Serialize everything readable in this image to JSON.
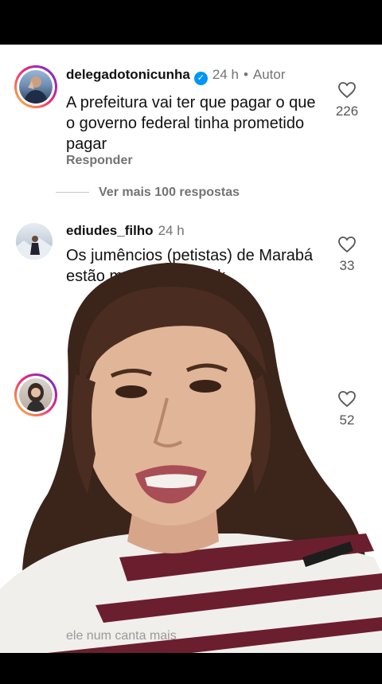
{
  "comments": [
    {
      "username": "delegadotonicunha",
      "time": "24 h",
      "author_label": "Autor",
      "text": "A prefeitura vai ter que pagar o que o governo federal tinha prometido pagar",
      "likes": "226",
      "reply_label": "Responder"
    },
    {
      "username": "ediudes_filho",
      "time": "24 h",
      "text": "Os jumêncios (petistas) de Marabá estão mordendo kkkkk",
      "likes": "33"
    },
    {
      "likes": "52"
    }
  ],
  "view_more_label": "Ver mais 100 respostas",
  "caption": "ele num canta mais",
  "colors": {
    "verified": "#0095f6",
    "muted": "#737373"
  },
  "icons": [
    "heart-icon",
    "verified-badge-icon"
  ]
}
